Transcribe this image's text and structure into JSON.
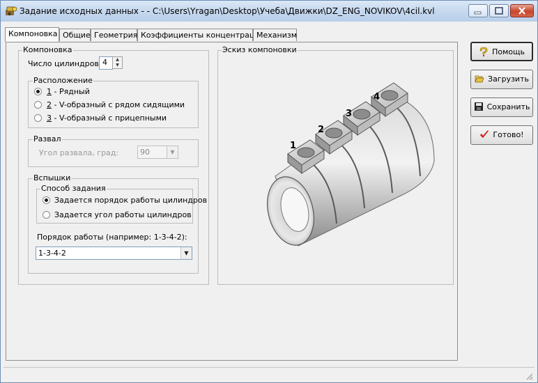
{
  "window": {
    "title": "Задание исходных данных -  - C:\\Users\\Yragan\\Desktop\\Учеба\\Движки\\DZ_ENG_NOVIKOV\\4cil.kvl"
  },
  "tabs": [
    {
      "label": "Компоновка",
      "active": true
    },
    {
      "label": "Общие"
    },
    {
      "label": "Геометрия"
    },
    {
      "label": "Коэффициенты концентрации"
    },
    {
      "label": "Механизм"
    }
  ],
  "layout_group": {
    "title": "Компоновка",
    "cylinders_label": "Число цилиндров:",
    "cylinders_value": "4",
    "arrangement": {
      "title": "Расположение",
      "options": [
        {
          "key": "1",
          "text": " - Рядный",
          "selected": true
        },
        {
          "key": "2",
          "text": " - V-образный с рядом сидящими",
          "selected": false
        },
        {
          "key": "3",
          "text": " - V-образный с прицепными",
          "selected": false
        }
      ]
    },
    "camber": {
      "title": "Развал",
      "angle_label": "Угол развала, град:",
      "angle_value": "90"
    },
    "flashes": {
      "title": "Вспышки",
      "method_title": "Способ задания",
      "method_options": [
        {
          "text": "Задается порядок работы цилиндров",
          "selected": true
        },
        {
          "text": "Задается угол работы цилиндров",
          "selected": false
        }
      ],
      "order_label": "Порядок работы (например: 1-3-4-2):",
      "order_value": "1-3-4-2"
    }
  },
  "sketch": {
    "title": "Эскиз компоновки",
    "cylinder_numbers": [
      "1",
      "2",
      "3",
      "4"
    ]
  },
  "buttons": {
    "help": "Помощь",
    "load": "Загрузить",
    "save": "Сохранить",
    "done": "Готово!"
  },
  "colors": {
    "titlebar": "#c4d7ee",
    "close_button": "#c8452b",
    "checkmark": "#cc1111",
    "help_icon": "#e8c21a"
  }
}
